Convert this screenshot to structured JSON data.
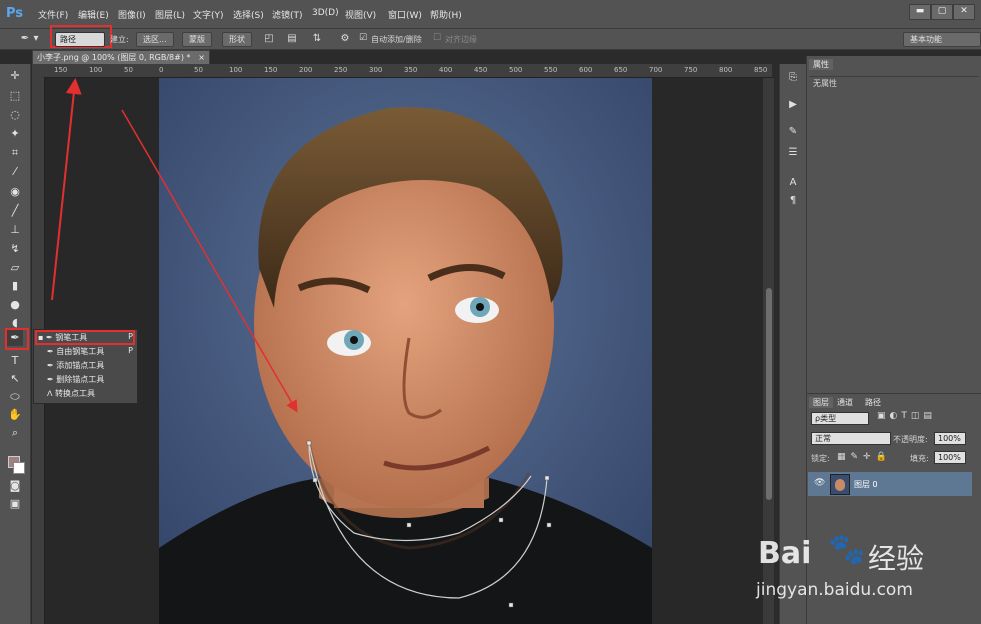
{
  "app": {
    "logo": "Ps"
  },
  "menu": [
    "文件(F)",
    "编辑(E)",
    "图像(I)",
    "图层(L)",
    "文字(Y)",
    "选择(S)",
    "滤镜(T)",
    "3D(D)",
    "视图(V)",
    "窗口(W)",
    "帮助(H)"
  ],
  "window_buttons": [
    "▬",
    "▢",
    "✕"
  ],
  "options": {
    "mode_select": "路径",
    "build_label": "建立:",
    "selection_btn": "选区...",
    "mask_btn": "蒙版",
    "shape_btn": "形状",
    "auto_add_label": "自动添加/删除",
    "align_edges_label": "对齐边缘",
    "workspace": "基本功能"
  },
  "document": {
    "tab_title": "小李子.png @ 100% (图层 0, RGB/8#) *",
    "ruler_ticks": [
      "150",
      "100",
      "50",
      "0",
      "50",
      "100",
      "150",
      "200",
      "250",
      "300",
      "350",
      "400",
      "450",
      "500",
      "550",
      "600",
      "650",
      "700",
      "750",
      "800",
      "850"
    ]
  },
  "tool_flyout": {
    "items": [
      {
        "label": "钢笔工具",
        "shortcut": "P"
      },
      {
        "label": "自由钢笔工具",
        "shortcut": "P"
      },
      {
        "label": "添加锚点工具",
        "shortcut": ""
      },
      {
        "label": "删除锚点工具",
        "shortcut": ""
      },
      {
        "label": "转换点工具",
        "shortcut": ""
      }
    ]
  },
  "properties_panel": {
    "tab": "属性",
    "content": "无属性"
  },
  "layers_panel": {
    "tabs": [
      "图层",
      "通道",
      "路径"
    ],
    "filter_kind": "ρ类型",
    "blend_mode": "正常",
    "opacity_label": "不透明度:",
    "opacity_value": "100%",
    "lock_label": "锁定:",
    "fill_label": "填充:",
    "fill_value": "100%",
    "layers": [
      {
        "name": "图层 0"
      }
    ]
  },
  "watermark": {
    "brand": "Bai",
    "brand_suffix": "经验",
    "url": "jingyan.baidu.com"
  },
  "colors": {
    "annotation": "#e23030",
    "ui_gray": "#535353"
  }
}
